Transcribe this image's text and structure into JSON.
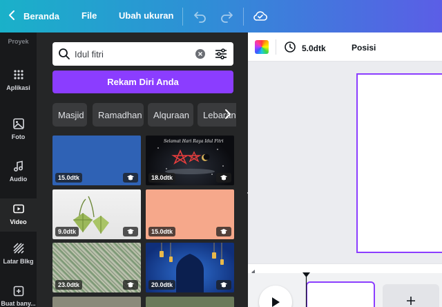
{
  "topbar": {
    "back_label": "Beranda",
    "file_label": "File",
    "resize_label": "Ubah ukuran"
  },
  "rail": {
    "items": [
      {
        "label": "Proyek",
        "icon": "folder-icon"
      },
      {
        "label": "Aplikasi",
        "icon": "apps-grid-icon"
      },
      {
        "label": "Foto",
        "icon": "photo-icon"
      },
      {
        "label": "Audio",
        "icon": "music-note-icon"
      },
      {
        "label": "Video",
        "icon": "video-icon",
        "active": true
      },
      {
        "label": "Latar Blkg",
        "icon": "background-pattern-icon"
      },
      {
        "label": "Buat bany...",
        "icon": "add-folder-icon"
      }
    ]
  },
  "panel": {
    "search_value": "Idul fitri",
    "record_label": "Rekam Diri Anda",
    "chips": [
      "Masjid",
      "Ramadhan",
      "Alquraan",
      "Lebaran"
    ],
    "videos": [
      {
        "duration": "15.0dtk",
        "premium": true
      },
      {
        "duration": "18.0dtk",
        "premium": true,
        "caption": "Selamat Hari Raya Idul Fitri"
      },
      {
        "duration": "9.0dtk",
        "premium": true
      },
      {
        "duration": "15.0dtk",
        "premium": true
      },
      {
        "duration": "23.0dtk",
        "premium": true
      },
      {
        "duration": "20.0dtk",
        "premium": true
      }
    ]
  },
  "toolbar": {
    "duration_label": "5.0dtk",
    "position_label": "Posisi"
  },
  "colors": {
    "accent": "#8b3dff",
    "rail_bg": "#18191b",
    "panel_bg": "#252627"
  }
}
